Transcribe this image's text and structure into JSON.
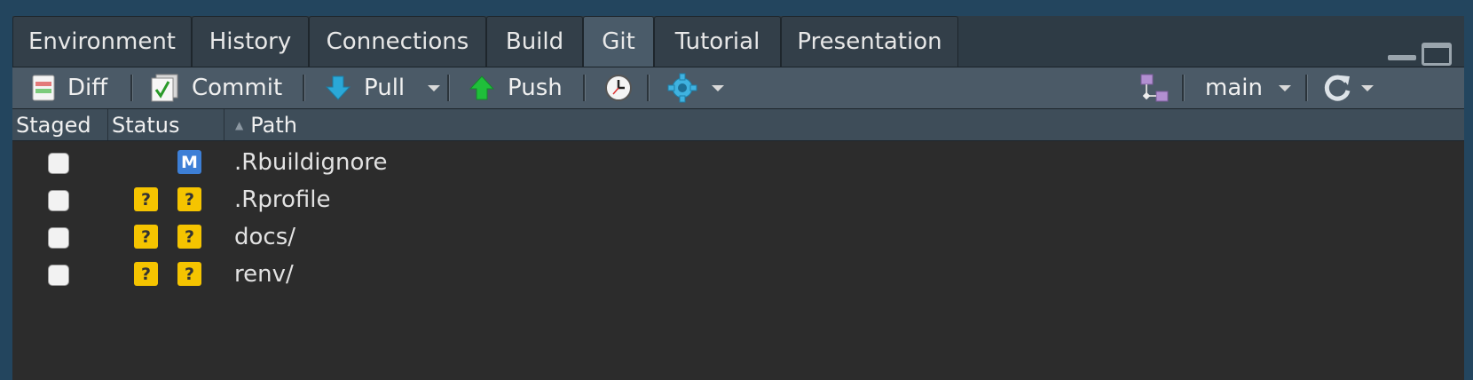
{
  "tabs": [
    {
      "label": "Environment"
    },
    {
      "label": "History"
    },
    {
      "label": "Connections"
    },
    {
      "label": "Build"
    },
    {
      "label": "Git"
    },
    {
      "label": "Tutorial"
    },
    {
      "label": "Presentation"
    }
  ],
  "active_tab": "Git",
  "toolbar": {
    "diff_label": "Diff",
    "commit_label": "Commit",
    "pull_label": "Pull",
    "push_label": "Push",
    "branch": "main",
    "icons": [
      "diff-icon",
      "commit-icon",
      "pull-icon",
      "push-icon",
      "history-icon",
      "gear-icon",
      "branch-icon",
      "refresh-icon"
    ]
  },
  "columns": {
    "staged": "Staged",
    "status": "Status",
    "path": "Path"
  },
  "files": [
    {
      "path": ".Rbuildignore",
      "status_index": "",
      "status_worktree": "M",
      "staged": false
    },
    {
      "path": ".Rprofile",
      "status_index": "?",
      "status_worktree": "?",
      "staged": false
    },
    {
      "path": "docs/",
      "status_index": "?",
      "status_worktree": "?",
      "staged": false
    },
    {
      "path": "renv/",
      "status_index": "?",
      "status_worktree": "?",
      "staged": false
    }
  ],
  "colors": {
    "question_badge": "#f5c400",
    "modified_badge": "#3d7fd6",
    "push_arrow": "#1fbf3a",
    "pull_arrow": "#2aa8d8"
  }
}
